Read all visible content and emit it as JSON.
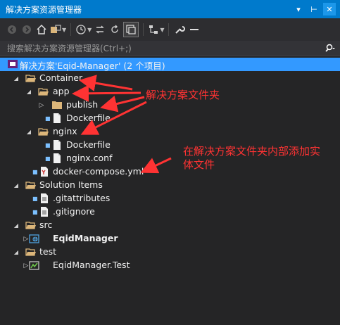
{
  "window": {
    "title": "解决方案资源管理器",
    "buttons": [
      "▾",
      "⊢",
      "✕"
    ]
  },
  "search": {
    "placeholder": "搜索解决方案资源管理器(Ctrl+;)",
    "icon": "search-icon"
  },
  "tree": {
    "solution_label": "解决方案'Eqid-Manager' (2 个项目)",
    "container": "Container",
    "app": "app",
    "publish": "publish",
    "dockerfile_app": "Dockerfile",
    "nginx": "nginx",
    "dockerfile_nginx": "Dockerfile",
    "nginx_conf": "nginx.conf",
    "docker_compose": "docker-compose.yml",
    "solution_items": "Solution Items",
    "gitattributes": ".gitattributes",
    "gitignore": ".gitignore",
    "src": "src",
    "eqid_manager": "EqidManager",
    "test": "test",
    "eqid_manager_test": "EqidManager.Test"
  },
  "annotations": {
    "solution_folder": "解决方案文件夹",
    "add_entity_line1": "在解决方案文件夹内部添加实",
    "add_entity_line2": "体文件"
  },
  "colors": {
    "background": "#252526",
    "titlebar": "#007acc",
    "selection": "#3399ff",
    "folder": "#dcb67a",
    "annotation": "#ff3333"
  }
}
